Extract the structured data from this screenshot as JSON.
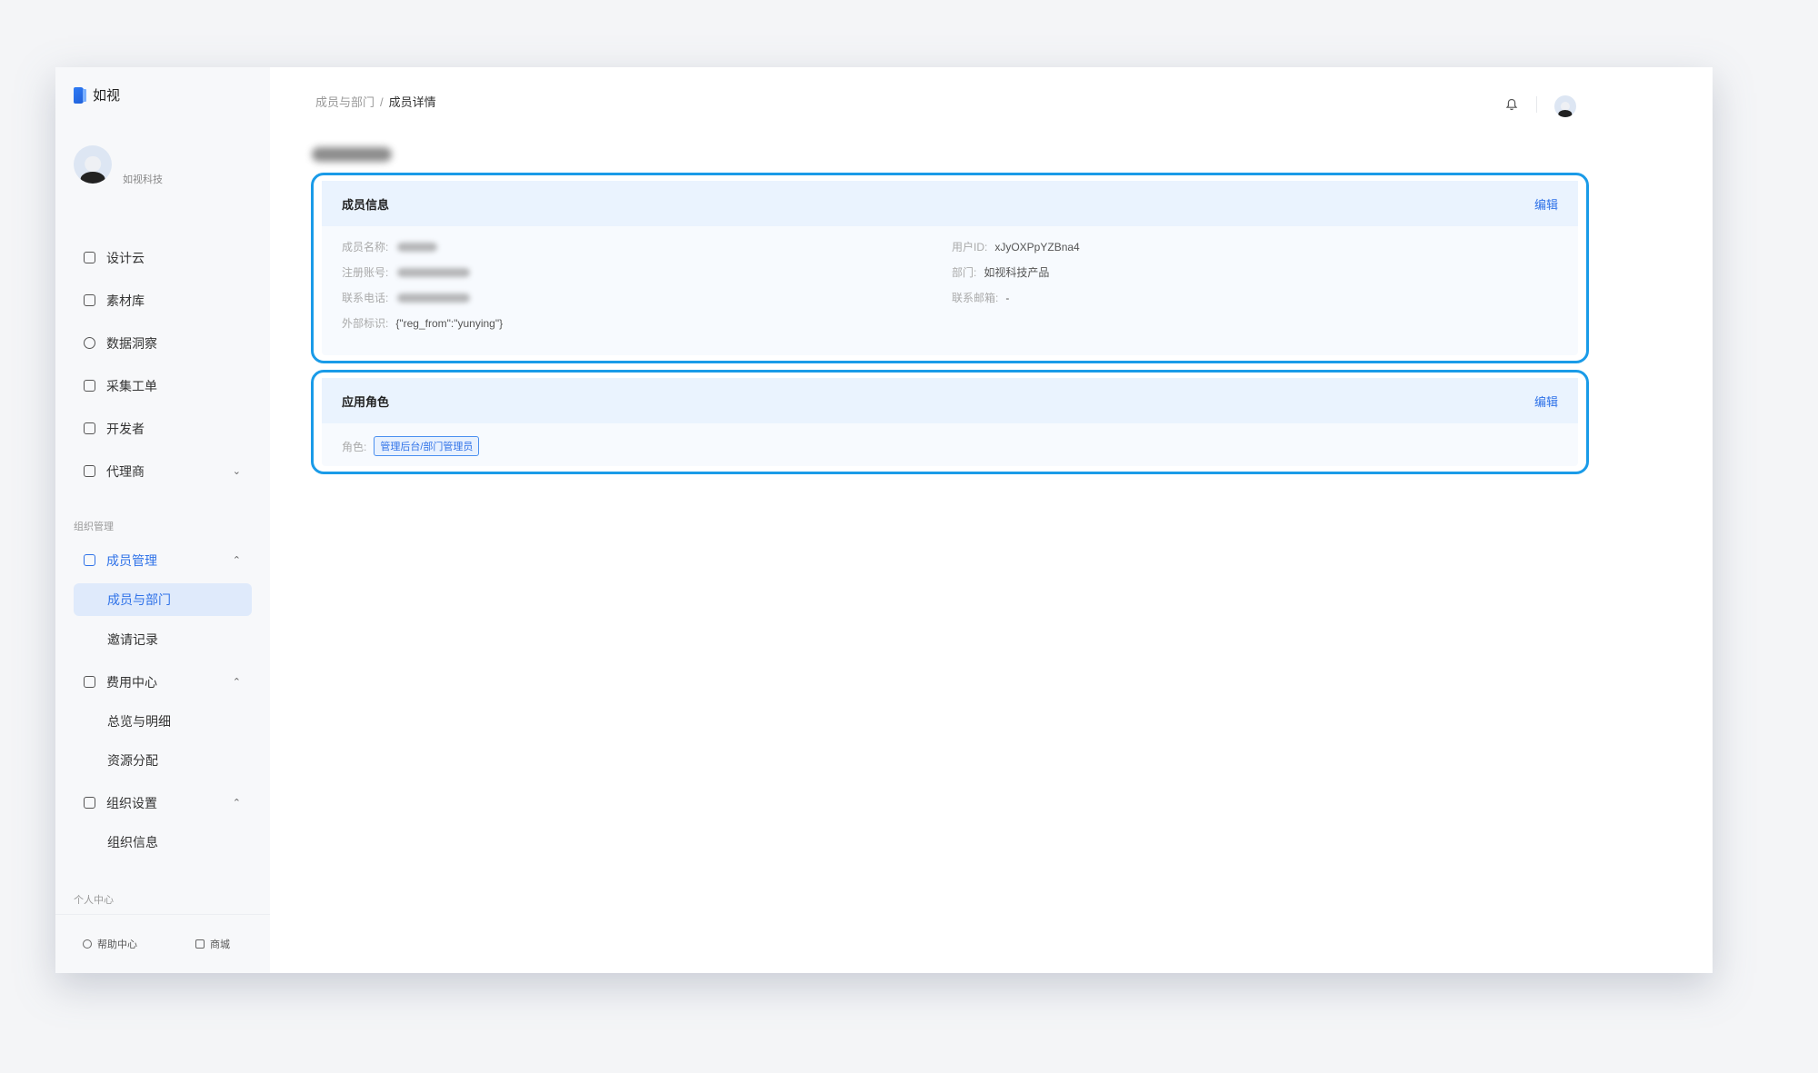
{
  "app": {
    "brand": "如视",
    "org_name": "如视科技"
  },
  "sidebar": {
    "items": [
      {
        "label": "设计云",
        "icon": "monitor-icon"
      },
      {
        "label": "素材库",
        "icon": "folder-icon"
      },
      {
        "label": "数据洞察",
        "icon": "pie-chart-icon"
      },
      {
        "label": "采集工单",
        "icon": "clipboard-icon"
      },
      {
        "label": "开发者",
        "icon": "code-icon"
      },
      {
        "label": "代理商",
        "icon": "briefcase-icon",
        "chevron": "⌄"
      }
    ],
    "org_section_label": "组织管理",
    "member_mgmt": {
      "label": "成员管理",
      "chevron": "⌃",
      "children": [
        "成员与部门",
        "邀请记录"
      ]
    },
    "fee_center": {
      "label": "费用中心",
      "chevron": "⌃",
      "children": [
        "总览与明细",
        "资源分配"
      ]
    },
    "org_settings": {
      "label": "组织设置",
      "chevron": "⌃",
      "children": [
        "组织信息"
      ]
    },
    "personal_section_label": "个人中心",
    "footer": {
      "help": "帮助中心",
      "store": "商城"
    }
  },
  "header": {
    "breadcrumb": [
      "成员与部门",
      "成员详情"
    ],
    "breadcrumb_sep": "/"
  },
  "member_info": {
    "title": "成员信息",
    "edit": "编辑",
    "name_label": "成员名称:",
    "account_label": "注册账号:",
    "phone_label": "联系电话:",
    "ext_label": "外部标识:",
    "ext_value": "{\"reg_from\":\"yunying\"}",
    "user_id_label": "用户ID:",
    "user_id_value": "xJyOXPpYZBna4",
    "dept_label": "部门:",
    "dept_value": "如视科技产品",
    "email_label": "联系邮箱:",
    "email_value": "-"
  },
  "app_roles": {
    "title": "应用角色",
    "edit": "编辑",
    "role_label": "角色:",
    "role_tag": "管理后台/部门管理员"
  },
  "colors": {
    "accent": "#2f72e8",
    "highlight_border": "#1a9be8"
  }
}
